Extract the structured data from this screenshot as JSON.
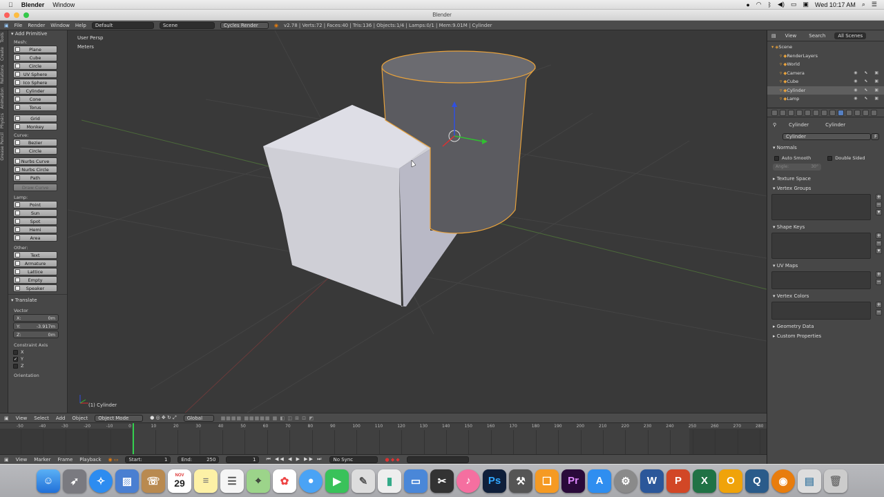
{
  "mac_menubar": {
    "app": "Blender",
    "menu": "Window",
    "time": "Wed 10:17 AM"
  },
  "window": {
    "title": "Blender"
  },
  "infobar": {
    "menus": [
      "File",
      "Render",
      "Window",
      "Help"
    ],
    "layout": "Default",
    "scene": "Scene",
    "engine": "Cycles Render",
    "stats": "v2.78 | Verts:72 | Faces:40 | Tris:136 | Objects:1/4 | Lamps:0/1 | Mem:9.01M | Cylinder"
  },
  "left_tabs": [
    "Tools",
    "Create",
    "Relations",
    "Animation",
    "Physics",
    "Grease Pencil"
  ],
  "toolshelf": {
    "title": "Add Primitive",
    "mesh_label": "Mesh:",
    "mesh": [
      "Plane",
      "Cube",
      "Circle",
      "UV Sphere",
      "Ico Sphere",
      "Cylinder",
      "Cone",
      "Torus"
    ],
    "mesh2": [
      "Grid",
      "Monkey"
    ],
    "curve_label": "Curve:",
    "curve": [
      "Bezier",
      "Circle"
    ],
    "curve2": [
      "Nurbs Curve",
      "Nurbs Circle",
      "Path"
    ],
    "curve_disabled": "Draw Curve",
    "lamp_label": "Lamp:",
    "lamp": [
      "Point",
      "Sun",
      "Spot",
      "Hemi",
      "Area"
    ],
    "other_label": "Other:",
    "other": [
      "Text",
      "Armature",
      "Lattice",
      "Empty",
      "Speaker"
    ]
  },
  "operator": {
    "title": "Translate",
    "vector_label": "Vector",
    "x_label": "X:",
    "x": "0m",
    "y_label": "Y:",
    "y": "-3.917m",
    "z_label": "Z:",
    "z": "0m",
    "constraint_label": "Constraint Axis",
    "axes": [
      {
        "label": "X",
        "checked": false
      },
      {
        "label": "Y",
        "checked": true
      },
      {
        "label": "Z",
        "checked": false
      }
    ],
    "orientation_label": "Orientation"
  },
  "viewport": {
    "view_name": "User Persp",
    "units": "Meters",
    "object_label": "(1) Cylinder"
  },
  "viewport_header": {
    "menus": [
      "View",
      "Select",
      "Add",
      "Object"
    ],
    "mode": "Object Mode",
    "orientation": "Global"
  },
  "timeline": {
    "ticks": [
      "-50",
      "-40",
      "-30",
      "-20",
      "-10",
      "0",
      "10",
      "20",
      "30",
      "40",
      "50",
      "60",
      "70",
      "80",
      "90",
      "100",
      "110",
      "120",
      "130",
      "140",
      "150",
      "160",
      "170",
      "180",
      "190",
      "200",
      "210",
      "220",
      "230",
      "240",
      "250",
      "260",
      "270",
      "280"
    ],
    "current_frame_value": 0
  },
  "timeline_header": {
    "menus": [
      "View",
      "Marker",
      "Frame",
      "Playback"
    ],
    "start_label": "Start:",
    "start": "1",
    "end_label": "End:",
    "end": "250",
    "current": "1",
    "sync": "No Sync"
  },
  "outliner": {
    "tabs": [
      "View",
      "Search",
      "All Scenes"
    ],
    "items": [
      {
        "label": "Scene",
        "indent": 0
      },
      {
        "label": "RenderLayers",
        "indent": 1
      },
      {
        "label": "World",
        "indent": 1
      },
      {
        "label": "Camera",
        "indent": 1
      },
      {
        "label": "Cube",
        "indent": 1
      },
      {
        "label": "Cylinder",
        "indent": 1,
        "selected": true
      },
      {
        "label": "Lamp",
        "indent": 1
      }
    ]
  },
  "properties": {
    "breadcrumb_obj": "Cylinder",
    "breadcrumb_data": "Cylinder",
    "datablock": "Cylinder",
    "datablock_users": "F",
    "normals": "Normals",
    "auto_smooth": "Auto Smooth",
    "double_sided": "Double Sided",
    "angle": "Angle:",
    "angle_value": "30°",
    "texture_space": "Texture Space",
    "vertex_groups": "Vertex Groups",
    "shape_keys": "Shape Keys",
    "uv_maps": "UV Maps",
    "vertex_colors": "Vertex Colors",
    "geometry_data": "Geometry Data",
    "custom_properties": "Custom Properties"
  },
  "dock": {
    "calendar_month": "NOV",
    "calendar_day": "29"
  },
  "colors": {
    "selection_outline": "#e8a23c",
    "header_bg": "#4b4b4b",
    "panel_bg": "#474747",
    "viewport_bg": "#393939",
    "active_blue": "#5680c2"
  }
}
